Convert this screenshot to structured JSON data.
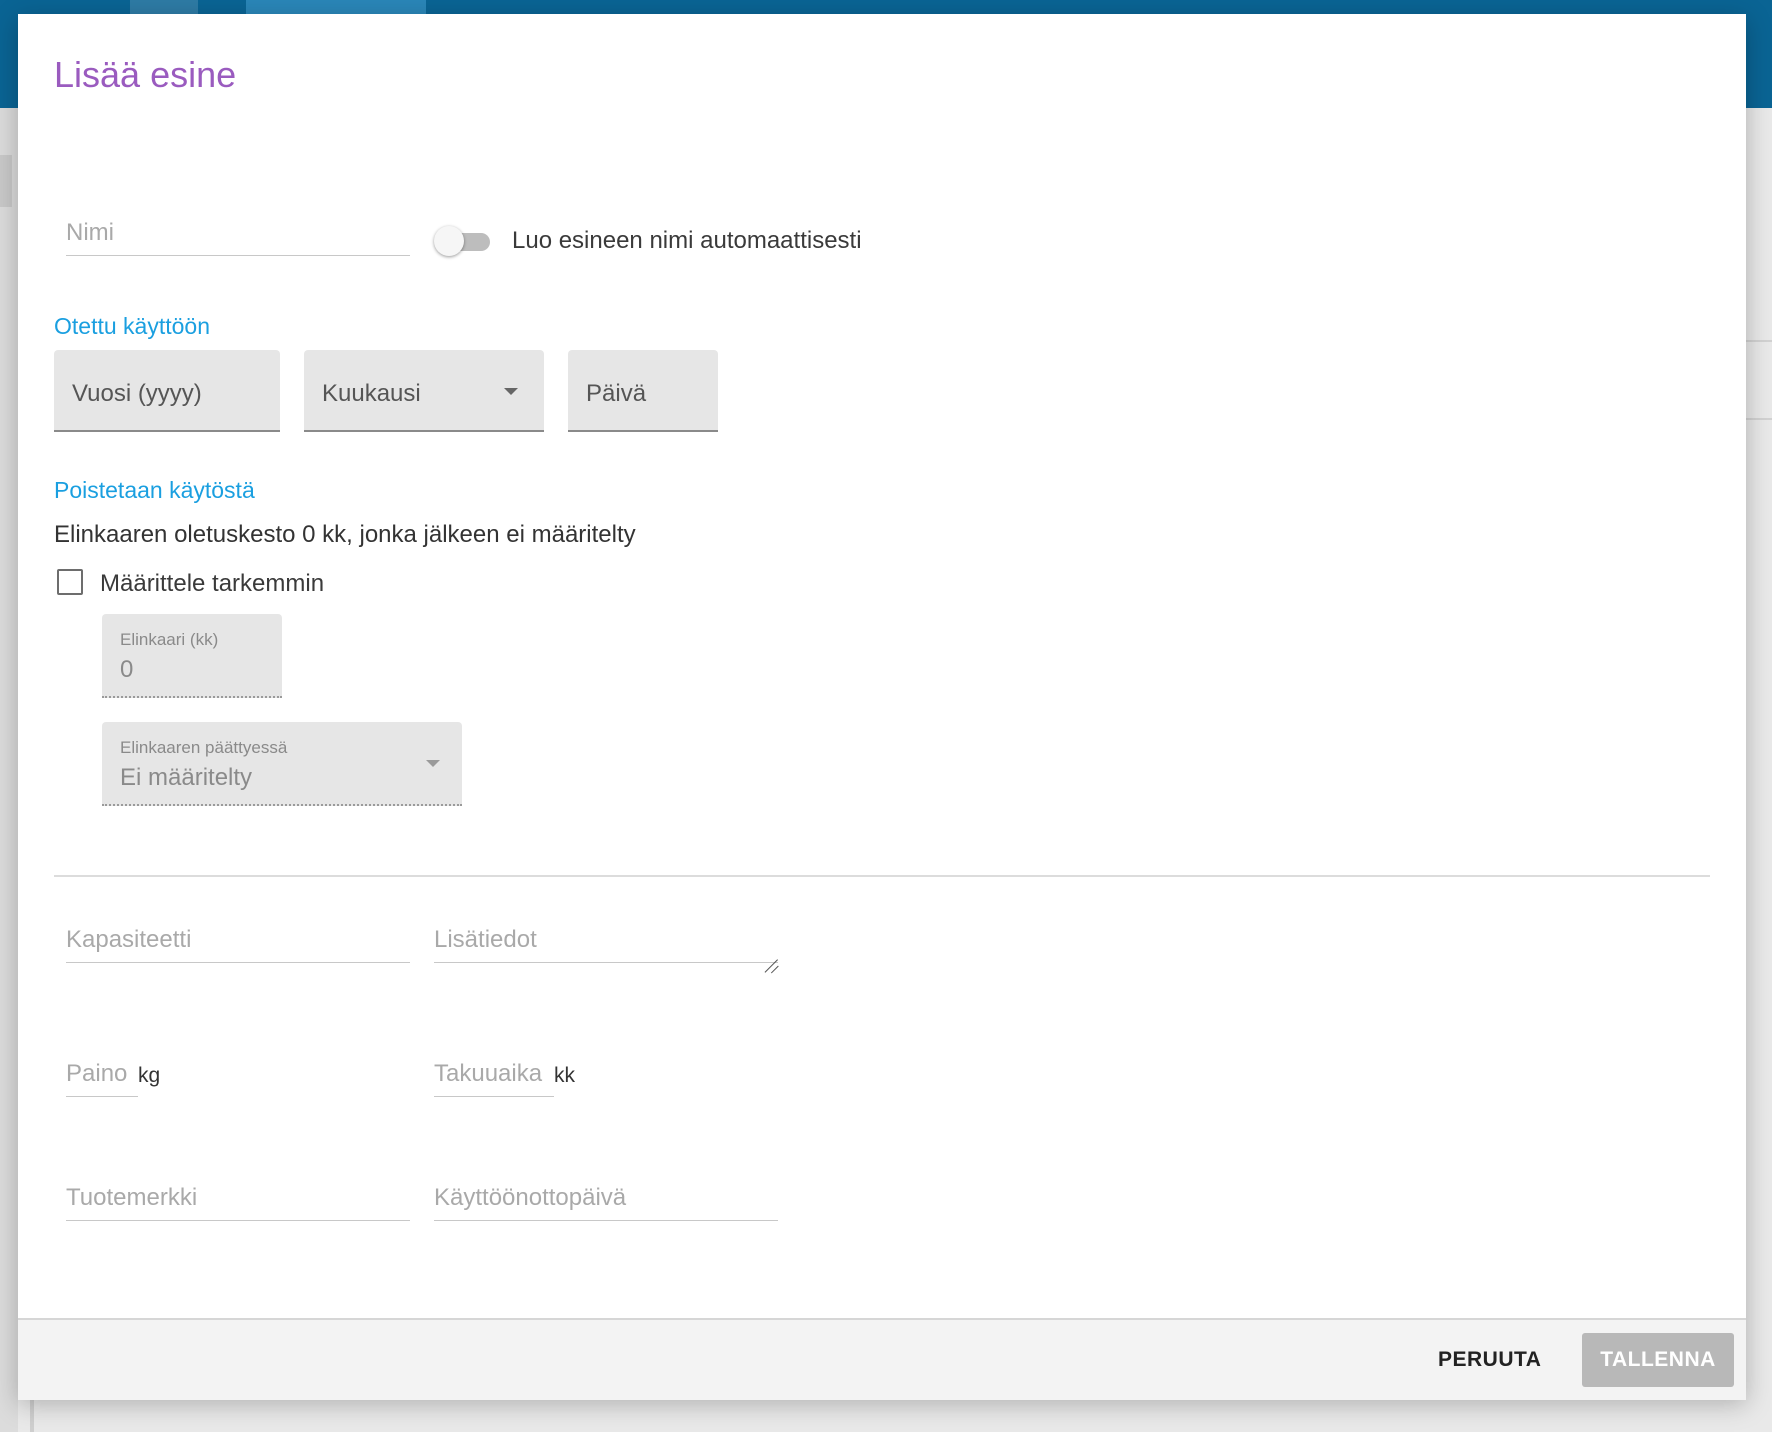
{
  "dialog": {
    "title": "Lisää esine"
  },
  "name_field": {
    "placeholder": "Nimi"
  },
  "auto_name_toggle": {
    "label": "Luo esineen nimi automaattisesti",
    "checked": false
  },
  "commissioned": {
    "heading": "Otettu käyttöön",
    "year_label": "Vuosi (yyyy)",
    "month_label": "Kuukausi",
    "day_label": "Päivä"
  },
  "decommission": {
    "heading": "Poistetaan käytöstä",
    "info_text": "Elinkaaren oletuskesto 0 kk, jonka jälkeen ei määritelty",
    "specify_checkbox_label": "Määrittele tarkemmin",
    "specify_checked": false,
    "lifecycle_label": "Elinkaari (kk)",
    "lifecycle_value": "0",
    "end_action_label": "Elinkaaren päättyessä",
    "end_action_value": "Ei määritelty"
  },
  "details": {
    "capacity_placeholder": "Kapasiteetti",
    "notes_placeholder": "Lisätiedot",
    "weight_placeholder": "Paino",
    "weight_unit": "kg",
    "warranty_placeholder": "Takuuaika",
    "warranty_unit": "kk",
    "brand_placeholder": "Tuotemerkki",
    "commission_date_placeholder": "Käyttöönottopäivä"
  },
  "footer": {
    "cancel_label": "PERUUTA",
    "save_label": "TALLENNA"
  },
  "colors": {
    "title": "#9a5bbf",
    "section_heading": "#1a9fe0",
    "app_bar": "#0a6494",
    "save_button_disabled": "#b8b8b8"
  }
}
